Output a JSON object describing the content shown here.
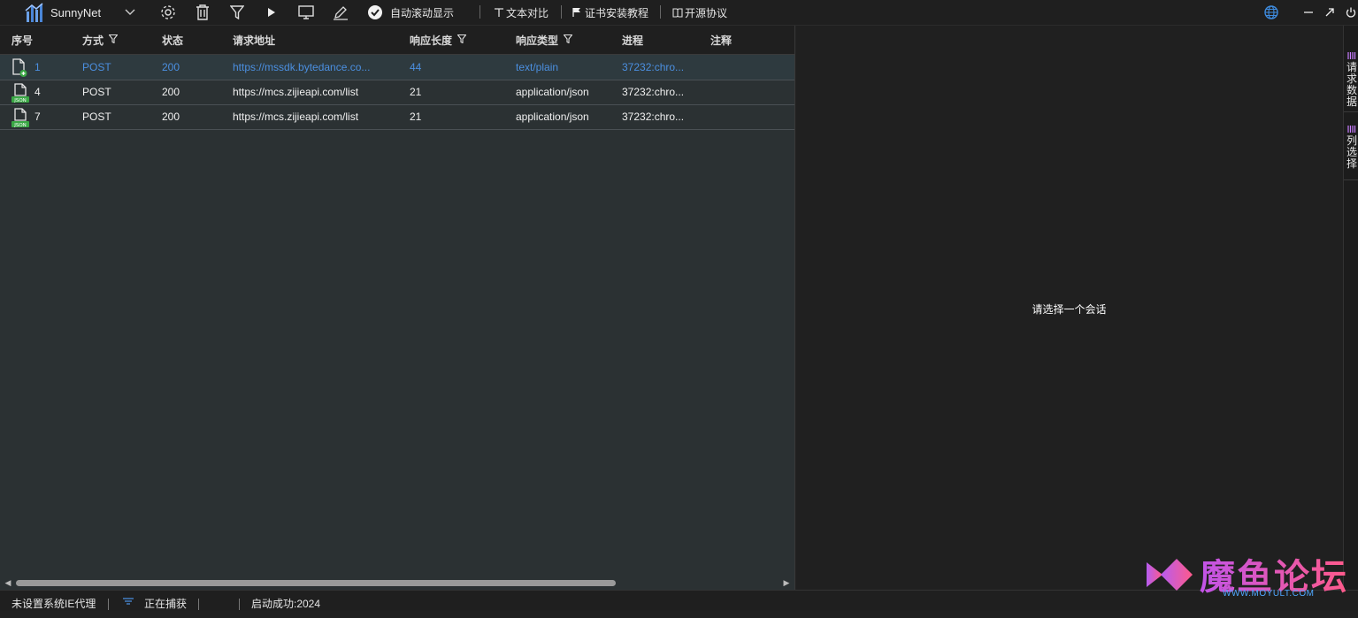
{
  "app": {
    "title": "SunnyNet"
  },
  "toolbar": {
    "autoscroll_label": "自动滚动显示",
    "text_compare_label": "文本对比",
    "cert_tutorial_label": "证书安装教程",
    "open_source_label": "开源协议"
  },
  "columns": {
    "index": "序号",
    "method": "方式",
    "status": "状态",
    "url": "请求地址",
    "length": "响应长度",
    "type": "响应类型",
    "process": "进程",
    "note": "注释"
  },
  "rows": [
    {
      "index": "1",
      "method": "POST",
      "status": "200",
      "url": "https://mssdk.bytedance.co...",
      "length": "44",
      "type": "text/plain",
      "process": "37232:chro...",
      "note": "",
      "icon": "document-plus-icon",
      "selected": true
    },
    {
      "index": "4",
      "method": "POST",
      "status": "200",
      "url": "https://mcs.zijieapi.com/list",
      "length": "21",
      "type": "application/json",
      "process": "37232:chro...",
      "note": "",
      "icon": "json-file-icon",
      "selected": false
    },
    {
      "index": "7",
      "method": "POST",
      "status": "200",
      "url": "https://mcs.zijieapi.com/list",
      "length": "21",
      "type": "application/json",
      "process": "37232:chro...",
      "note": "",
      "icon": "json-file-icon",
      "selected": false
    }
  ],
  "detail": {
    "placeholder": "请选择一个会话"
  },
  "side_tabs": {
    "request_data": "请求数据",
    "column_select": "列选择"
  },
  "status": {
    "proxy": "未设置系统IE代理",
    "capture": "正在捕获",
    "startup": "启动成功:2024"
  },
  "watermark": {
    "text": "魔鱼论坛",
    "url": "WWW.MOYULT.COM"
  },
  "colors": {
    "accent": "#4b8fe0",
    "selected_row": "#2e3a3f",
    "list_bg": "#2b3133"
  }
}
